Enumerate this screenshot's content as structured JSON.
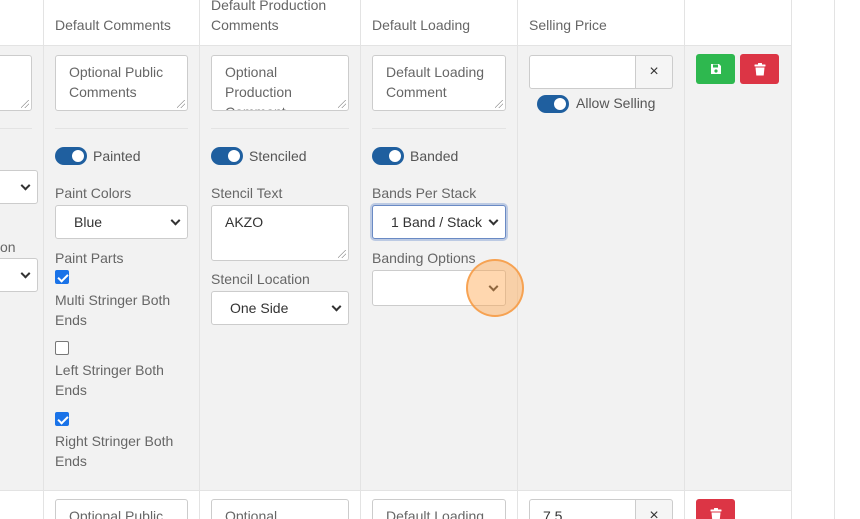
{
  "columns": {
    "default_comments": "Default Comments",
    "default_production_comments_line1": "Default Production",
    "default_production_comments_line2": "Comments",
    "default_loading": "Default Loading",
    "selling_price": "Selling Price"
  },
  "row1": {
    "comments_placeholder_l1": "Optional Public",
    "comments_placeholder_l2": "Comments",
    "production_placeholder_l1": "Optional",
    "production_placeholder_l2": "Production",
    "production_placeholder_l3": "Comment",
    "loading_placeholder_l1": "Default Loading",
    "loading_placeholder_l2": "Comment",
    "selling_price_value": "",
    "clear_symbol": "×",
    "allow_selling_label": "Allow Selling",
    "painted_label": "Painted",
    "paint_colors_label": "Paint Colors",
    "paint_colors_value": "Blue",
    "paint_parts_label": "Paint Parts",
    "multi_stringer_l1": "Multi Stringer Both",
    "multi_stringer_l2": "Ends",
    "left_stringer_l1": "Left Stringer Both",
    "left_stringer_l2": "Ends",
    "right_stringer_l1": "Right Stringer Both",
    "right_stringer_l2": "Ends",
    "stenciled_label": "Stenciled",
    "stencil_text_label": "Stencil Text",
    "stencil_text_value": "AKZO",
    "stencil_location_label": "Stencil Location",
    "stencil_location_value": "One Side",
    "banded_label": "Banded",
    "bands_per_stack_label": "Bands Per Stack",
    "bands_per_stack_value": "1 Band / Stack",
    "banding_options_label": "Banding Options",
    "banding_options_value": "",
    "left_partial_text": "on"
  },
  "row2": {
    "comments_placeholder": "Optional Public",
    "production_placeholder": "Optional",
    "loading_placeholder": "Default Loading",
    "selling_price_value": "7.5",
    "clear_symbol": "×"
  },
  "colors": {
    "toggle_on": "#1f5f9f",
    "save_green": "#2eb84f",
    "delete_red": "#dc3545",
    "checkbox_blue": "#1a73e8"
  }
}
